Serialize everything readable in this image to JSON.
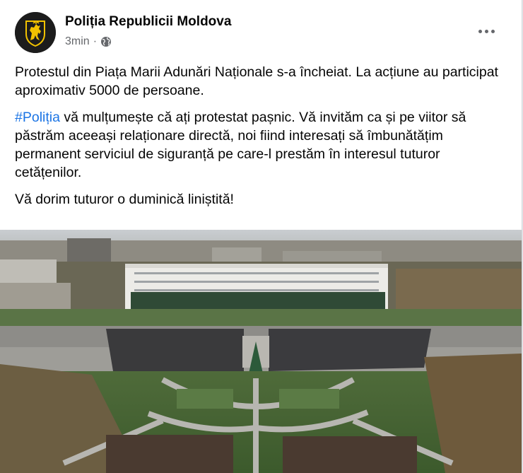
{
  "post": {
    "author": "Poliția Republicii Moldova",
    "time": "3min",
    "separator": "·",
    "privacy_icon": "globe-icon",
    "more_icon": "more-horizontal-icon",
    "paragraph1": "Protestul  din Piața Marii Adunări Naționale  s-a încheiat. La acțiune au participat aproximativ 5000 de persoane.",
    "hashtag": "#Poliția",
    "paragraph2_rest": " vă mulțumește că ați protestat pașnic. Vă invităm ca și pe viitor să păstrăm aceeași relaționare directă, noi fiind interesați să îmbunătățim permanent serviciul de siguranță pe care-l prestăm în interesul tuturor cetățenilor.",
    "paragraph3": "Vă dorim tuturor o duminică liniștită!"
  },
  "colors": {
    "card_bg": "#ffffff",
    "text_primary": "#050505",
    "text_secondary": "#65676b",
    "hashtag": "#1b74e4",
    "avatar_bg": "#1c1c1c",
    "emblem": "#f2c200"
  }
}
